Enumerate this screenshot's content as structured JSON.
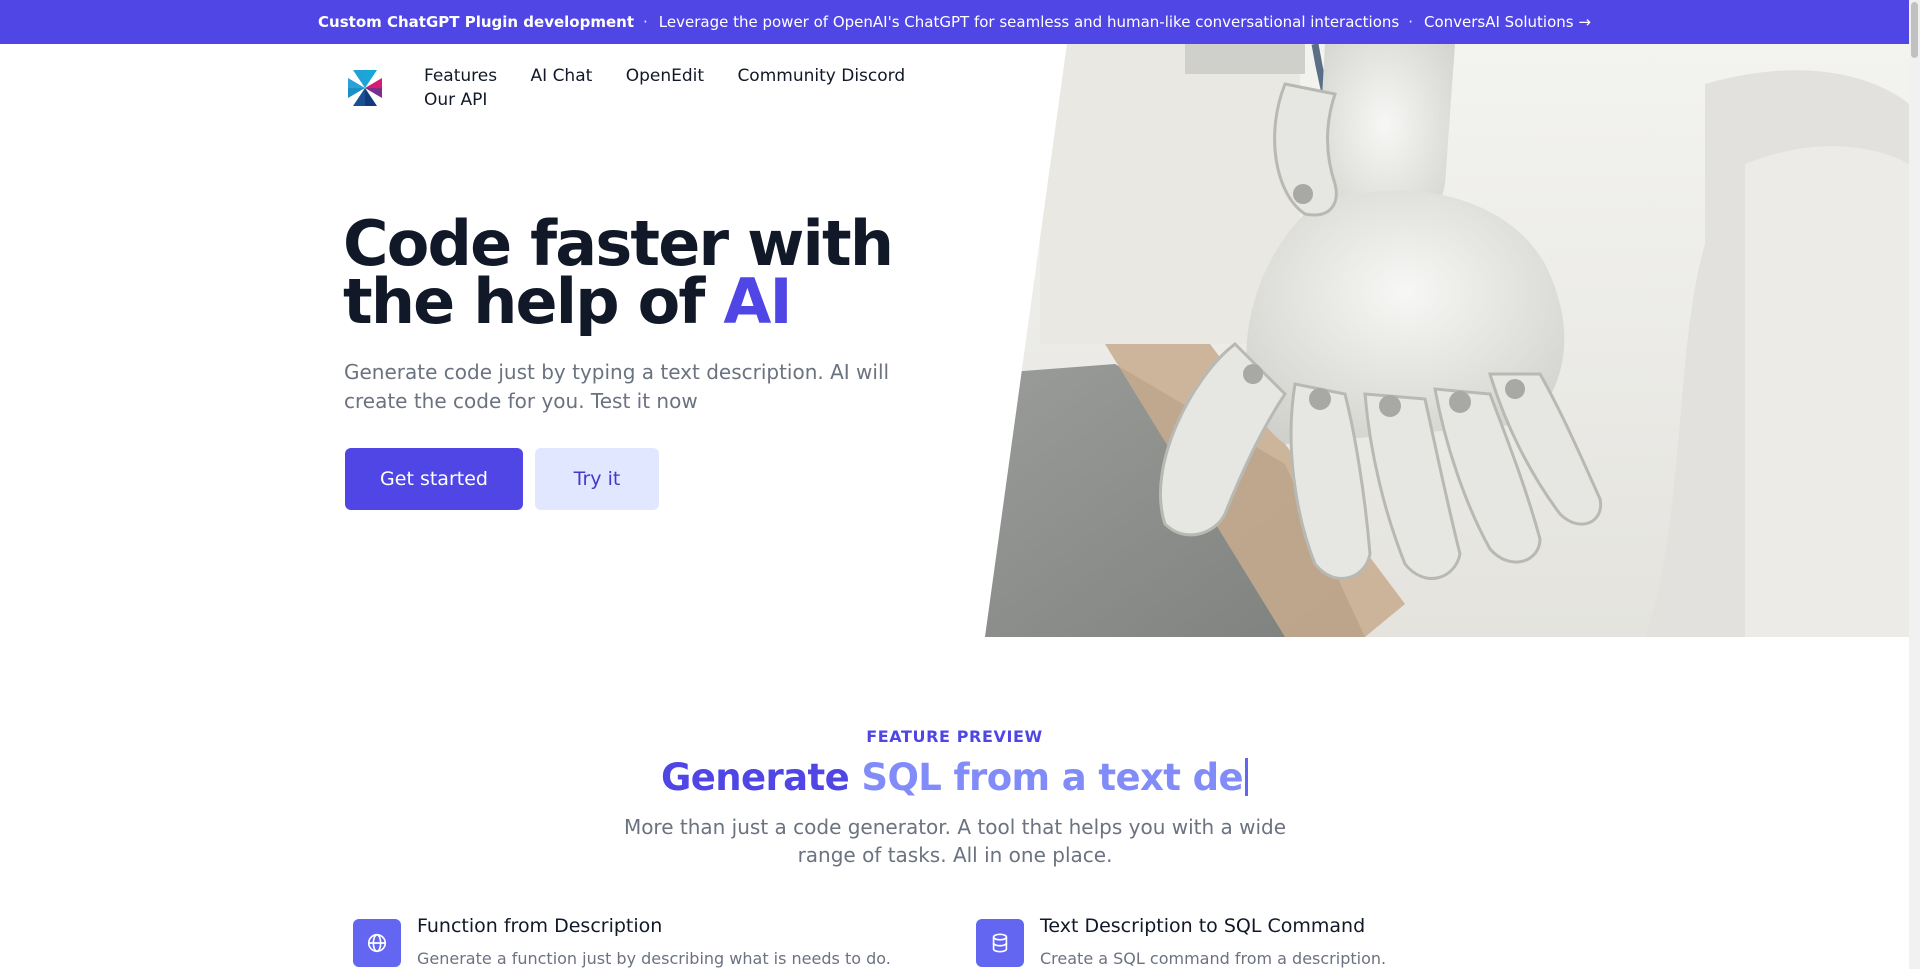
{
  "banner": {
    "title": "Custom ChatGPT Plugin development",
    "separator": "·",
    "message": "Leverage the power of OpenAI's ChatGPT for seamless and human-like conversational interactions",
    "link_label": "ConversAI Solutions →",
    "background": "#4f46e5"
  },
  "nav": {
    "logo_icon": "brand-logo-icon",
    "items": [
      {
        "label": "Features"
      },
      {
        "label": "AI Chat"
      },
      {
        "label": "OpenEdit"
      },
      {
        "label": "Community Discord"
      },
      {
        "label": "Our API"
      }
    ]
  },
  "hero": {
    "title_main": "Code faster with the help of ",
    "title_accent": "AI",
    "subtitle": "Generate code just by typing a text description. AI will create the code for you. Test it now",
    "primary_button": "Get started",
    "secondary_button": "Try it",
    "image_icon": "robot-hand-photo"
  },
  "preview": {
    "eyebrow": "FEATURE PREVIEW",
    "title_prefix": "Generate ",
    "title_typed": "SQL from a text de",
    "subtitle": "More than just a code generator. A tool that helps you with a wide range of tasks. All in one place."
  },
  "features": [
    {
      "icon": "globe-icon",
      "title": "Function from Description",
      "description": "Generate a function just by describing what is needs to do."
    },
    {
      "icon": "database-icon",
      "title": "Text Description to SQL Command",
      "description": "Create a SQL command from a description."
    }
  ],
  "colors": {
    "accent": "#4f46e5",
    "accent_light": "#818cf8",
    "secondary_button_bg": "#e0e7ff",
    "text_dark": "#111827",
    "text_muted": "#6b7280"
  }
}
